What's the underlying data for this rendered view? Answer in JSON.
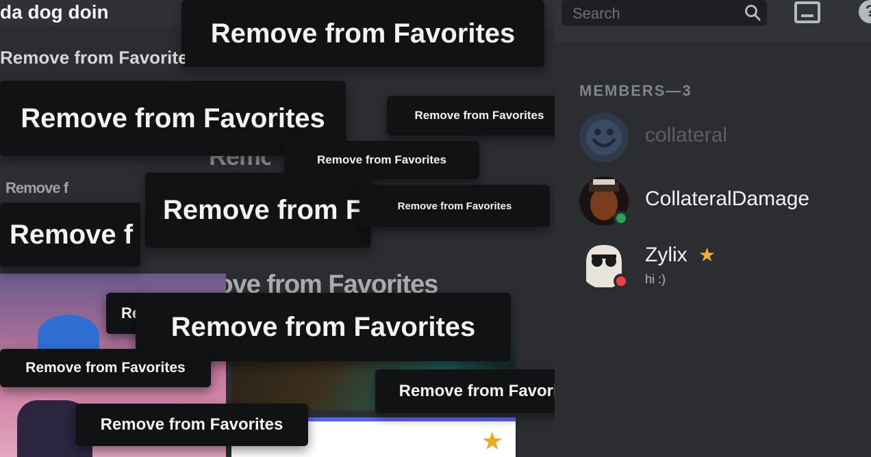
{
  "chat": {
    "channel_title": "da dog doin",
    "garbled_lines": [
      "Remove f",
      "Remove from Favorites",
      "Remove from Favorites"
    ]
  },
  "tooltip_label": "Remove from Favorites",
  "tooltips": [
    {
      "label": "Remove from Favorites"
    },
    {
      "label": "Remove from Favorites"
    },
    {
      "label": "Remove from Favorites"
    },
    {
      "label": "Remove from Favorites"
    },
    {
      "label": "Remove from F"
    },
    {
      "label": "Remove from Favorites"
    },
    {
      "label": "Remove f"
    },
    {
      "label": "Remove from Favorites"
    },
    {
      "label": "Remove from Favorites"
    },
    {
      "label": "Remove from Favorites"
    },
    {
      "label": "Remove from Favorites"
    },
    {
      "label": "Remove from Favorites"
    },
    {
      "label": "Remove from Favorites"
    }
  ],
  "topbar": {
    "search_placeholder": "Search",
    "search_icon": "search-icon",
    "inbox_icon": "inbox-icon",
    "help_icon": "help-icon",
    "help_glyph": "?"
  },
  "members": {
    "header": "MEMBERS—3",
    "list": [
      {
        "name": "collateral",
        "status": "offline",
        "name_color": "#5c5f66"
      },
      {
        "name": "CollateralDamage",
        "status": "online",
        "name_color": "#f2f3f5"
      },
      {
        "name": "Zylix",
        "sub": "hi :)",
        "status": "dnd",
        "owner": true,
        "crown": "★",
        "name_color": "#f2f3f5"
      }
    ]
  },
  "colors": {
    "background": "#313338",
    "sidebar": "#2b2d31",
    "tooltip_bg": "#111214",
    "online": "#23a55a",
    "dnd": "#f23f43",
    "owner_crown": "#f0b232",
    "favorite_star": "#f0a81c"
  }
}
